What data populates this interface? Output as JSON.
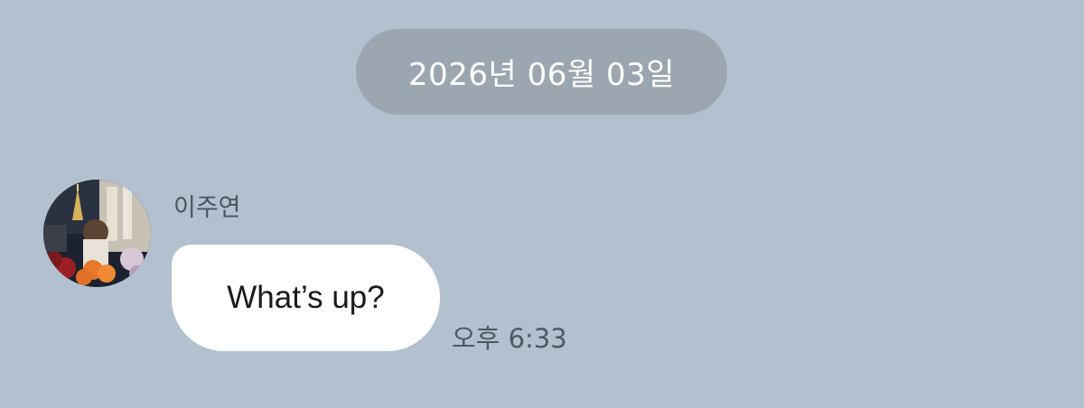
{
  "date_divider": {
    "label": "2026년 06월 03일"
  },
  "message": {
    "sender": "이주연",
    "text": "What’s up?",
    "time": "오후 6:33"
  },
  "avatar": {
    "icon": "profile-photo"
  },
  "colors": {
    "background": "#b2c0cf",
    "date_pill": "#9ca6b0",
    "bubble": "#ffffff"
  }
}
